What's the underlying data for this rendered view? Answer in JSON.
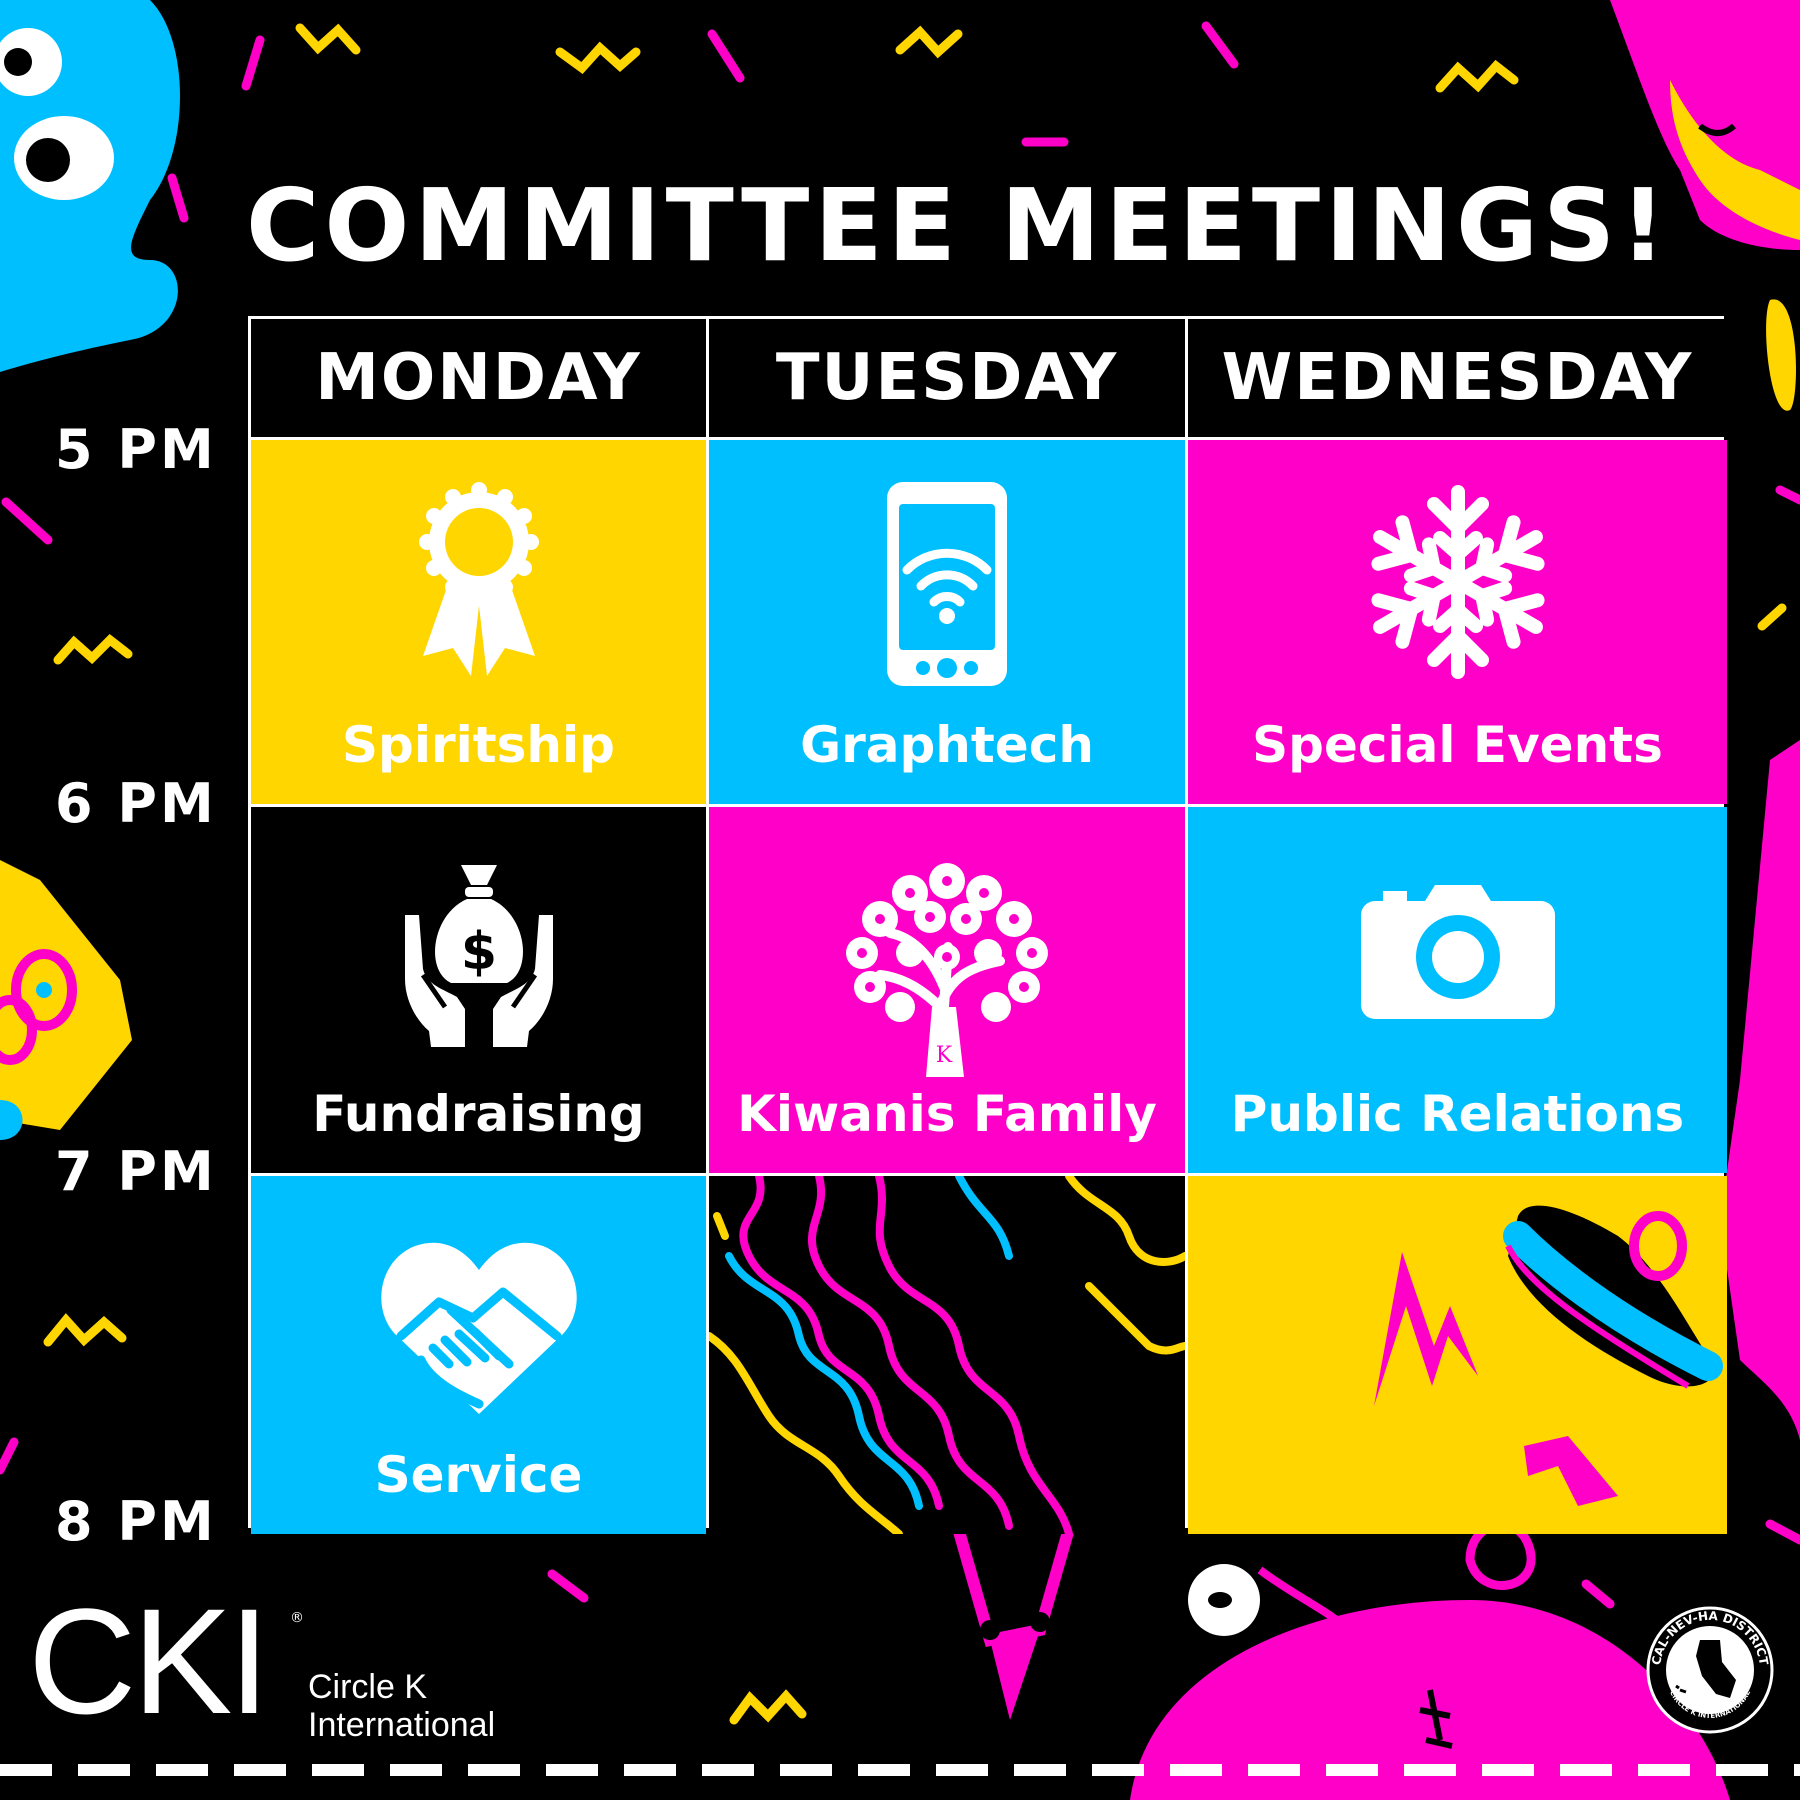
{
  "title": "COMMITTEE MEETINGS!",
  "days": [
    "MONDAY",
    "TUESDAY",
    "WEDNESDAY"
  ],
  "times": [
    "5 PM",
    "6 PM",
    "7 PM",
    "8 PM"
  ],
  "committees": {
    "spiritship": {
      "label": "Spiritship",
      "icon": "ribbon-icon"
    },
    "graphtech": {
      "label": "Graphtech",
      "icon": "phone-wifi-icon"
    },
    "special_events": {
      "label": "Special Events",
      "icon": "snowflake-icon"
    },
    "fundraising": {
      "label": "Fundraising",
      "icon": "money-bag-hands-icon"
    },
    "kiwanis_family": {
      "label": "Kiwanis Family",
      "icon": "tree-icon"
    },
    "public_relations": {
      "label": "Public Relations",
      "icon": "camera-icon"
    },
    "service": {
      "label": "Service",
      "icon": "handshake-heart-icon"
    }
  },
  "logo": {
    "mark": "CKI",
    "line1": "Circle K",
    "line2": "International"
  },
  "seal": {
    "top": "CAL-NEV-HA DISTRICT",
    "bottom": "CIRCLE K INTERNATIONAL"
  },
  "colors": {
    "yellow": "#FFD600",
    "cyan": "#00BFFF",
    "magenta": "#FF00C8",
    "black": "#000000",
    "white": "#FFFFFF"
  }
}
